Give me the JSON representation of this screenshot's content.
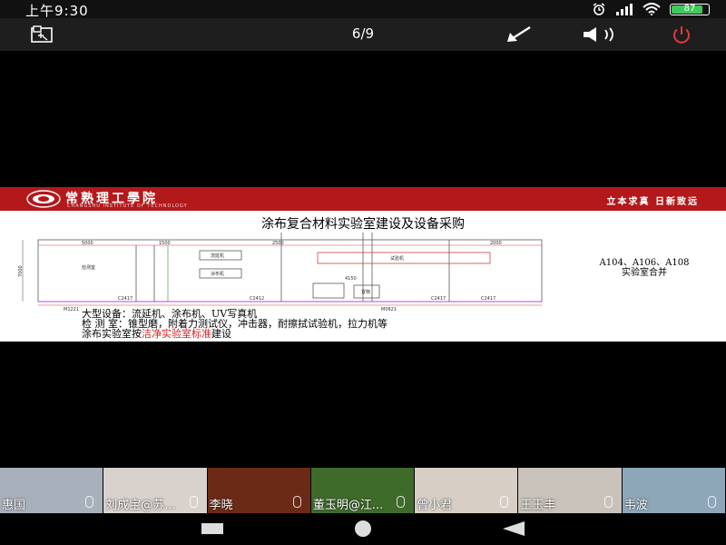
{
  "status_bar": {
    "time": "上午9:30",
    "battery_level": "87",
    "battery_fraction": 0.87,
    "icons": [
      "alarm-icon",
      "signal-icon",
      "wifi-icon",
      "battery-icon"
    ]
  },
  "toolbar": {
    "page_counter": "6/9",
    "icons": [
      "exit-fullscreen-icon",
      "minimize-arrow-icon",
      "speaker-icon",
      "power-icon"
    ],
    "power_color": "#e53935"
  },
  "slide": {
    "banner_color": "#b3191b",
    "school_name": "常熟理工學院",
    "school_name_en": "CHANGSHU INSTITUTE OF TECHNOLOGY",
    "motto": "立本求真 日新致远",
    "title": "涂布复合材料实验室建设及设备采购",
    "plan_labels": {
      "dim_left": "5000",
      "dim_mid1": "1500",
      "dim_mid2": "2500",
      "dim_right": "2000",
      "dim_center": "4150",
      "room_left": "检测室",
      "machine_1": "流延机",
      "machine_2": "涂布机",
      "machine_3": "试验机",
      "room_small": "置物",
      "door_1": "M1221",
      "door_2": "C2417",
      "door_3": "C2412",
      "door_4": "M0821",
      "door_5": "C2417",
      "door_6": "C2417",
      "side_dim": "7000"
    },
    "room_note_line1": "A104、A106、A108",
    "room_note_line2": "实验室合并",
    "text_line1": "大型设备：流延机、涂布机、UV写真机",
    "text_line2": "检 测 室：锥型磨，附着力测试仪，冲击器，耐擦拭试验机，拉力机等",
    "text_line3_a": "涂布实验室按",
    "text_line3_b": "洁净实验室标准",
    "text_line3_c": "建设",
    "highlight_color": "#d42020"
  },
  "participants": [
    {
      "name": "惠国",
      "bg": "#a8b0bb"
    },
    {
      "name": "刘成宝@苏...",
      "bg": "#d9d2cc"
    },
    {
      "name": "李晓",
      "bg": "#6a2a16"
    },
    {
      "name": "董玉明@江...",
      "bg": "#3f6b2a"
    },
    {
      "name": "曾小君",
      "bg": "#d7cfc5"
    },
    {
      "name": "王玉丰",
      "bg": "#c9c2bb"
    },
    {
      "name": "韦波",
      "bg": "#8da7b8"
    }
  ],
  "navbar": {
    "icons": [
      "recent-apps-icon",
      "home-icon",
      "back-icon"
    ]
  }
}
